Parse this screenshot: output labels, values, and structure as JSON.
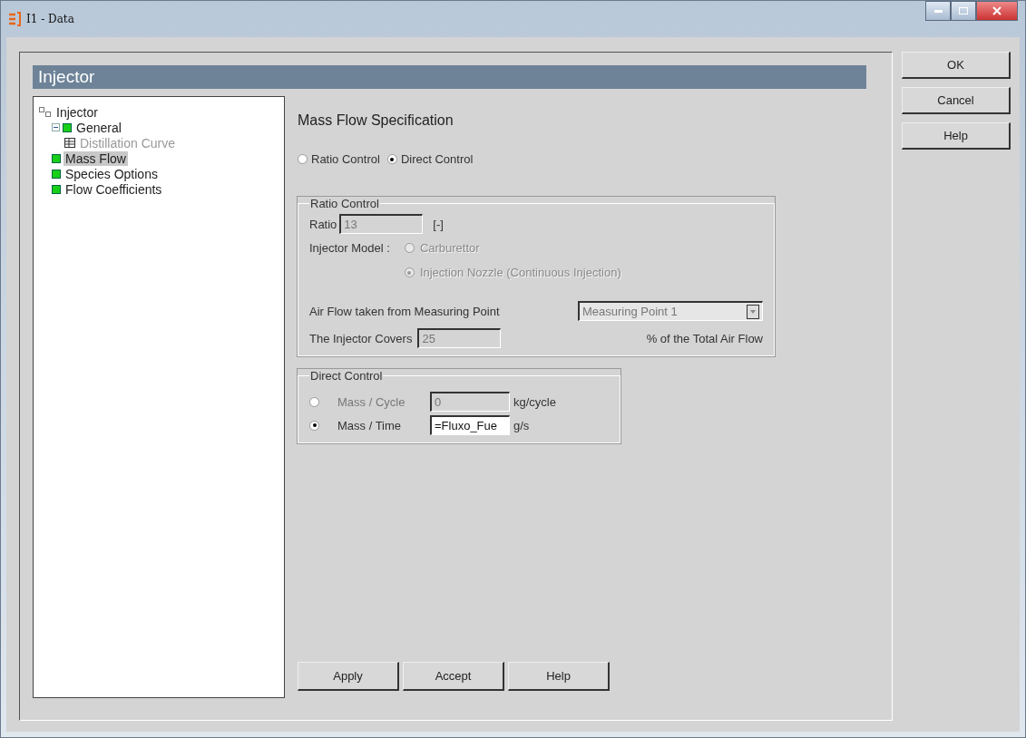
{
  "window": {
    "title": "I1 - Data"
  },
  "panel": {
    "title": "Injector"
  },
  "tree": {
    "label": "Injector",
    "selected": false,
    "children": [
      {
        "label": "General",
        "expanded": true,
        "selected": false,
        "disabled": false,
        "children": [
          {
            "label": "Distillation Curve",
            "selected": false,
            "disabled": true
          }
        ]
      },
      {
        "label": "Mass Flow",
        "selected": true,
        "disabled": false
      },
      {
        "label": "Species Options",
        "selected": false,
        "disabled": false
      },
      {
        "label": "Flow Coefficients",
        "selected": false,
        "disabled": false
      }
    ]
  },
  "form": {
    "heading": "Mass Flow Specification",
    "mode_options": [
      {
        "label": "Ratio Control",
        "selected": false
      },
      {
        "label": "Direct Control",
        "selected": true
      }
    ],
    "ratio_group": {
      "title": "Ratio Control",
      "disabled": true,
      "ratio": {
        "label": "Ratio",
        "value": "13",
        "unit": "[-]"
      },
      "injector_model": {
        "label": "Injector Model :",
        "options": [
          {
            "label": "Carburettor",
            "selected": false
          },
          {
            "label": "Injection Nozzle (Continuous Injection)",
            "selected": true
          }
        ]
      },
      "air_flow": {
        "label": "Air Flow taken from Measuring Point",
        "value": "Measuring Point 1"
      },
      "covers": {
        "label": "The Injector Covers",
        "value": "25",
        "unit": "%  of the Total Air Flow"
      }
    },
    "direct_group": {
      "title": "Direct Control",
      "rows": [
        {
          "label": "Mass / Cycle",
          "value": "0",
          "unit": "kg/cycle",
          "selected": false,
          "disabled": true
        },
        {
          "label": "Mass / Time",
          "value": "=Fluxo_Fue",
          "unit": "g/s",
          "selected": true,
          "disabled": false
        }
      ]
    },
    "buttons": [
      "Apply",
      "Accept",
      "Help"
    ]
  },
  "side_buttons": [
    "OK",
    "Cancel",
    "Help"
  ]
}
